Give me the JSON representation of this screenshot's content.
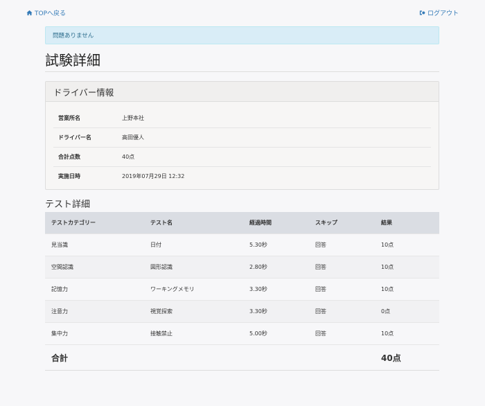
{
  "nav": {
    "top_link": "TOPへ戻る",
    "logout_link": "ログアウト"
  },
  "alert": {
    "message": "問題ありません"
  },
  "page_title": "試験詳細",
  "driver_panel": {
    "heading": "ドライバー情報",
    "rows": [
      {
        "label": "営業所名",
        "value": "上野本社"
      },
      {
        "label": "ドライバー名",
        "value": "高田優人"
      },
      {
        "label": "合計点数",
        "value": "40点"
      },
      {
        "label": "実施日時",
        "value": "2019年07月29日 12:32"
      }
    ]
  },
  "test_section": {
    "title": "テスト詳細",
    "columns": [
      "テストカテゴリー",
      "テスト名",
      "経過時間",
      "スキップ",
      "結果"
    ],
    "rows": [
      [
        "見当識",
        "日付",
        "5.30秒",
        "回答",
        "10点"
      ],
      [
        "空間認識",
        "図形認識",
        "2.80秒",
        "回答",
        "10点"
      ],
      [
        "記憶力",
        "ワーキングメモリ",
        "3.30秒",
        "回答",
        "10点"
      ],
      [
        "注意力",
        "視覚探索",
        "3.30秒",
        "回答",
        "0点"
      ],
      [
        "集中力",
        "接触禁止",
        "5.00秒",
        "回答",
        "10点"
      ]
    ],
    "total_label": "合計",
    "total_value": "40点"
  },
  "colors": {
    "link": "#337ab7",
    "alert_bg": "#d9edf7",
    "table_header_bg": "#dadde3"
  }
}
